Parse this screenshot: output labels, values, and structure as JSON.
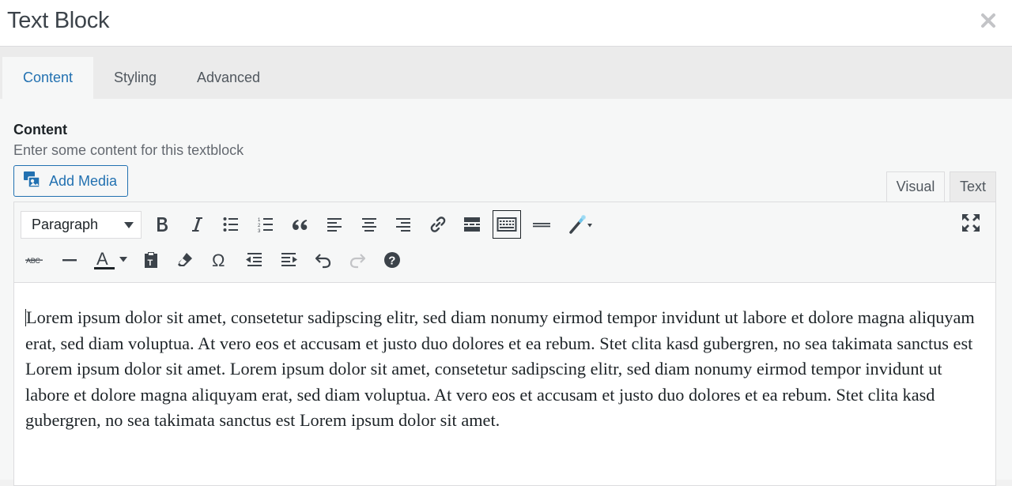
{
  "dialog": {
    "title": "Text Block",
    "close_icon": "close-icon"
  },
  "tabs": [
    {
      "label": "Content",
      "active": true
    },
    {
      "label": "Styling",
      "active": false
    },
    {
      "label": "Advanced",
      "active": false
    }
  ],
  "field": {
    "label": "Content",
    "description": "Enter some content for this textblock"
  },
  "add_media": {
    "label": "Add Media",
    "icon": "media-icon"
  },
  "editor_modes": {
    "visual": "Visual",
    "text": "Text",
    "active": "Visual"
  },
  "toolbar": {
    "format_select": "Paragraph",
    "row1": [
      "bold-icon",
      "italic-icon",
      "bulleted-list-icon",
      "numbered-list-icon",
      "blockquote-icon",
      "align-left-icon",
      "align-center-icon",
      "align-right-icon",
      "link-icon",
      "read-more-icon",
      "toolbar-toggle-icon",
      "horizontal-line-icon",
      "magic-wand-icon",
      "fullscreen-icon"
    ],
    "row2": [
      "strikethrough-icon",
      "horizontal-rule-icon",
      "text-color-icon",
      "paste-text-icon",
      "clear-formatting-icon",
      "special-character-icon",
      "outdent-icon",
      "indent-icon",
      "undo-icon",
      "redo-icon",
      "help-icon"
    ]
  },
  "content": {
    "text": "Lorem ipsum dolor sit amet, consetetur sadipscing elitr, sed diam nonumy eirmod tempor invidunt ut labore et dolore magna aliquyam erat, sed diam voluptua. At vero eos et accusam et justo duo dolores et ea rebum. Stet clita kasd gubergren, no sea takimata sanctus est Lorem ipsum dolor sit amet. Lorem ipsum dolor sit amet, consetetur sadipscing elitr, sed diam nonumy eirmod tempor invidunt ut labore et dolore magna aliquyam erat, sed diam voluptua. At vero eos et accusam et justo duo dolores et ea rebum. Stet clita kasd gubergren, no sea takimata sanctus est Lorem ipsum dolor sit amet."
  },
  "colors": {
    "accent": "#2271b1",
    "panel": "#f6f7f7",
    "border": "#dcdcde"
  }
}
